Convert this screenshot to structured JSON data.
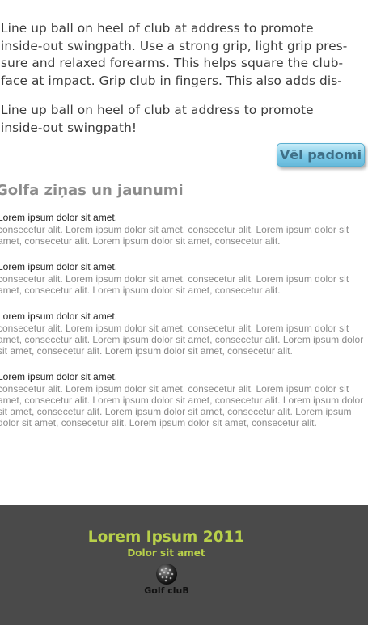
{
  "tips": {
    "paragraph1_lines": [
      "Line up ball on heel of club at  address to promote",
      "inside-out swingpath. Use a strong grip, light grip pres-",
      "sure and relaxed forearms. This helps square the club-",
      "face at impact. Grip club in fingers. This also adds dis-"
    ],
    "paragraph2_lines": [
      "Line up ball on heel of club at  address to promote",
      "inside-out swingpath!"
    ],
    "more_button_label": "Vēl padomi"
  },
  "news": {
    "title": "Golfa ziņas un jaunumi",
    "items": [
      {
        "title": "Lorem ipsum dolor sit amet.",
        "body_lines": [
          "consecetur alit. Lorem ipsum dolor sit amet, consecetur alit. Lorem ipsum dolor sit",
          "amet, consecetur alit. Lorem ipsum dolor sit amet, consecetur alit."
        ]
      },
      {
        "title": "Lorem ipsum dolor sit amet.",
        "body_lines": [
          "consecetur alit. Lorem ipsum dolor sit amet, consecetur alit. Lorem ipsum dolor sit",
          "amet, consecetur alit. Lorem ipsum dolor sit amet, consecetur alit."
        ]
      },
      {
        "title": "Lorem ipsum dolor sit amet.",
        "body_lines": [
          "consecetur alit. Lorem ipsum dolor sit amet, consecetur alit. Lorem ipsum dolor sit",
          "amet, consecetur alit. Lorem ipsum dolor sit amet, consecetur alit. Lorem ipsum dolor",
          "sit amet, consecetur alit. Lorem ipsum dolor sit amet, consecetur alit."
        ]
      },
      {
        "title": "Lorem ipsum dolor sit amet.",
        "body_lines": [
          "consecetur alit. Lorem ipsum dolor sit amet, consecetur alit. Lorem ipsum dolor sit",
          "amet, consecetur alit. Lorem ipsum dolor sit amet, consecetur alit. Lorem ipsum dolor",
          "sit amet, consecetur alit. Lorem ipsum dolor sit amet, consecetur alit. Lorem ipsum",
          "dolor sit amet, consecetur alit. Lorem ipsum dolor sit amet, consecetur alit."
        ]
      }
    ]
  },
  "footer": {
    "title": "Lorem Ipsum 2011",
    "subtitle": "Dolor sit amet",
    "logo_text": "Golf cluB",
    "logo_icon": "golf-ball-icon"
  },
  "colors": {
    "footer_bg": "#4a4a4a",
    "footer_accent": "#b8d04a",
    "button_bg": "#7ecbe9",
    "news_title": "#8c8c8c"
  }
}
